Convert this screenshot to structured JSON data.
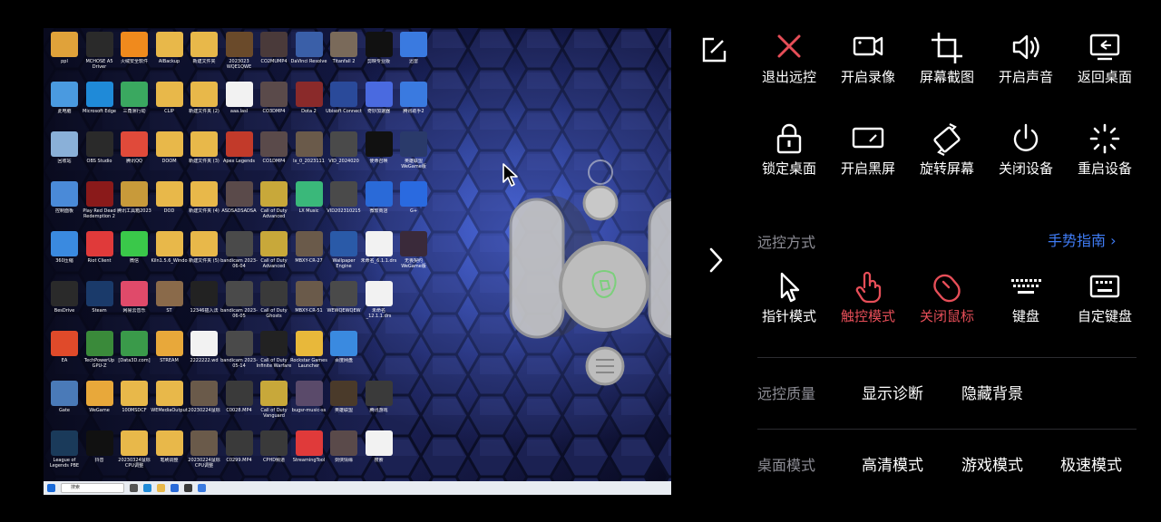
{
  "desktop": {
    "icons": [
      {
        "label": "ppl",
        "color": "#e0a23a"
      },
      {
        "label": "MCHOSE A5 Driver",
        "color": "#2a2a2a"
      },
      {
        "label": "火绒安全软件",
        "color": "#f08a1d"
      },
      {
        "label": "AIBackup",
        "color": "#e8b84a"
      },
      {
        "label": "新建文件夹",
        "color": "#e8b84a"
      },
      {
        "label": "2023023 WQE1QWE",
        "color": "#6a4a2a"
      },
      {
        "label": "CO2MUMP4",
        "color": "#4a3a3a"
      },
      {
        "label": "DaVinci Resolve",
        "color": "#3a5fa8"
      },
      {
        "label": "Titanfall 2",
        "color": "#7a6a5a"
      },
      {
        "label": "剪映专业版",
        "color": "#111111"
      },
      {
        "label": "迅雷",
        "color": "#3a7ae0"
      },
      {
        "label": "此电脑",
        "color": "#4a9ae0"
      },
      {
        "label": "Microsoft Edge",
        "color": "#1f8ad8"
      },
      {
        "label": "三角洲行动",
        "color": "#3aa860"
      },
      {
        "label": "CLIP",
        "color": "#e8b84a"
      },
      {
        "label": "新建文件夹 (2)",
        "color": "#e8b84a"
      },
      {
        "label": "aaa.lasl",
        "color": "#f2f2f2"
      },
      {
        "label": "CO3DMP4",
        "color": "#5a4a4a"
      },
      {
        "label": "Dota 2",
        "color": "#8a2a2a"
      },
      {
        "label": "Ubisoft Connect",
        "color": "#2a4a9a"
      },
      {
        "label": "奇妙加速器",
        "color": "#4a6ae0"
      },
      {
        "label": "腾讯助手2",
        "color": "#3a7ae0"
      },
      {
        "label": "回收站",
        "color": "#8ab0d8"
      },
      {
        "label": "OBS Studio",
        "color": "#2a2a2a"
      },
      {
        "label": "腾讯QQ",
        "color": "#e04a3a"
      },
      {
        "label": "DOOM",
        "color": "#e8b84a"
      },
      {
        "label": "新建文件夹 (3)",
        "color": "#e8b84a"
      },
      {
        "label": "Apex Legends",
        "color": "#c23a2a"
      },
      {
        "label": "CO1DMP4",
        "color": "#5a4a4a"
      },
      {
        "label": "lx_0_2023111",
        "color": "#6a5a4a"
      },
      {
        "label": "VID_2024020",
        "color": "#4a4a4a"
      },
      {
        "label": "使命召唤",
        "color": "#111111"
      },
      {
        "label": "英雄联盟WeGame版",
        "color": "#2a3a6a"
      },
      {
        "label": "控制面板",
        "color": "#4a8ad8"
      },
      {
        "label": "Play Red Dead Redemption 2",
        "color": "#8a1a1a"
      },
      {
        "label": "腾讯工具箱2023",
        "color": "#c89a3a"
      },
      {
        "label": "DOD",
        "color": "#e8b84a"
      },
      {
        "label": "新建文件夹 (4)",
        "color": "#e8b84a"
      },
      {
        "label": "ASDSADSADSA",
        "color": "#5a4a4a"
      },
      {
        "label": "Call of Duty Advanced",
        "color": "#c8a83a"
      },
      {
        "label": "LX Music",
        "color": "#3ab87a"
      },
      {
        "label": "VID202310215",
        "color": "#4a4a4a"
      },
      {
        "label": "微软商店",
        "color": "#2a6ad8"
      },
      {
        "label": "G+",
        "color": "#2a6ae0"
      },
      {
        "label": "360压缩",
        "color": "#3a8ae0"
      },
      {
        "label": "Riot Client",
        "color": "#e03a3a"
      },
      {
        "label": "微信",
        "color": "#3ac84a"
      },
      {
        "label": "Kiln1.5.6_Windo",
        "color": "#e8b84a"
      },
      {
        "label": "新建文件夹 (5)",
        "color": "#e8b84a"
      },
      {
        "label": "bandicam 2023-06-04",
        "color": "#4a4a4a"
      },
      {
        "label": "Call of Duty Advanced",
        "color": "#c8a83a"
      },
      {
        "label": "MBXY-CR-27",
        "color": "#6a5a4a"
      },
      {
        "label": "Wallpaper Engine",
        "color": "#2a5aa8"
      },
      {
        "label": "未命名_6.1.1.drs",
        "color": "#f2f2f2"
      },
      {
        "label": "无畏契约WeGame版",
        "color": "#3a2a3a"
      },
      {
        "label": "BesDrive",
        "color": "#2a2a2a"
      },
      {
        "label": "Steam",
        "color": "#1a3a6a"
      },
      {
        "label": "网易云音乐",
        "color": "#e04a6a"
      },
      {
        "label": "ST",
        "color": "#8a6a4a"
      },
      {
        "label": "12346插入法",
        "color": "#222222"
      },
      {
        "label": "bandicam 2023-06-05",
        "color": "#4a4a4a"
      },
      {
        "label": "Call of Duty Ghosts",
        "color": "#3a3a3a"
      },
      {
        "label": "MBXY-CR-51",
        "color": "#6a5a4a"
      },
      {
        "label": "WEWQEWQEW",
        "color": "#4a4a4a"
      },
      {
        "label": "未命名_12.1.1.drs",
        "color": "#f2f2f2"
      },
      {
        "label": "",
        "color": ""
      },
      {
        "label": "EA",
        "color": "#e04a2a"
      },
      {
        "label": "TechPowerUp GPU-Z",
        "color": "#3a8a3a"
      },
      {
        "label": "[Data3D.com]",
        "color": "#3a9a4a"
      },
      {
        "label": "STREAM",
        "color": "#e8a83a"
      },
      {
        "label": "2222222.wd",
        "color": "#f2f2f2"
      },
      {
        "label": "bandicam 2023-05-14",
        "color": "#4a4a4a"
      },
      {
        "label": "Call of Duty Infinite Warfare",
        "color": "#222222"
      },
      {
        "label": "Rockstar Games Launcher",
        "color": "#e8b83a"
      },
      {
        "label": "百度网盘",
        "color": "#3a8ae0"
      },
      {
        "label": "",
        "color": ""
      },
      {
        "label": "",
        "color": ""
      },
      {
        "label": "Gate",
        "color": "#4a7ab8"
      },
      {
        "label": "WeGame",
        "color": "#e8a83a"
      },
      {
        "label": "100MSDCF",
        "color": "#e8b84a"
      },
      {
        "label": "WEMediaOutput",
        "color": "#e8b84a"
      },
      {
        "label": "20230224鼠标",
        "color": "#6a5a4a"
      },
      {
        "label": "C0028.MP4",
        "color": "#3a3a3a"
      },
      {
        "label": "Call of Duty Vanguard",
        "color": "#c8a83a"
      },
      {
        "label": "bugsr-music-ss",
        "color": "#5a4a6a"
      },
      {
        "label": "英雄联盟",
        "color": "#4a3a2a"
      },
      {
        "label": "腾讯游戏",
        "color": "#3a3a3a"
      },
      {
        "label": "",
        "color": ""
      },
      {
        "label": "League of Legends PBE",
        "color": "#1a3a5a"
      },
      {
        "label": "抖音",
        "color": "#111111"
      },
      {
        "label": "20230324鼠标CPU调整",
        "color": "#e8b84a"
      },
      {
        "label": "笔刷调整",
        "color": "#e8b84a"
      },
      {
        "label": "20230224鼠标CPU调整",
        "color": "#6a5a4a"
      },
      {
        "label": "C0299.MP4",
        "color": "#3a3a3a"
      },
      {
        "label": "CPHD频道",
        "color": "#3a3a3a"
      },
      {
        "label": "StreamingTool",
        "color": "#e03a3a"
      },
      {
        "label": "剑侠情缘",
        "color": "#5a4a4a"
      },
      {
        "label": "搜索",
        "color": "#f2f2f2"
      },
      {
        "label": "",
        "color": ""
      }
    ],
    "taskbar": {
      "search_placeholder": "搜索"
    }
  },
  "panel": {
    "row1": [
      {
        "label": "退出远控",
        "icon": "close-icon",
        "accent": true
      },
      {
        "label": "开启录像",
        "icon": "video-camera-icon",
        "accent": false
      },
      {
        "label": "屏幕截图",
        "icon": "crop-icon",
        "accent": false
      },
      {
        "label": "开启声音",
        "icon": "speaker-icon",
        "accent": false
      },
      {
        "label": "返回桌面",
        "icon": "desktop-icon",
        "accent": false
      }
    ],
    "row2": [
      {
        "label": "锁定桌面",
        "icon": "lock-icon",
        "accent": false
      },
      {
        "label": "开启黑屏",
        "icon": "black-screen-icon",
        "accent": false
      },
      {
        "label": "旋转屏幕",
        "icon": "rotate-screen-icon",
        "accent": false
      },
      {
        "label": "关闭设备",
        "icon": "power-icon",
        "accent": false
      },
      {
        "label": "重启设备",
        "icon": "restart-icon",
        "accent": false
      }
    ],
    "control_mode_label": "远控方式",
    "gesture_guide": "手势指南 ›",
    "row3": [
      {
        "label": "指针模式",
        "icon": "pointer-icon",
        "accent": false
      },
      {
        "label": "触控模式",
        "icon": "touch-icon",
        "accent": true
      },
      {
        "label": "关闭鼠标",
        "icon": "mouse-off-icon",
        "accent": true
      },
      {
        "label": "键盘",
        "icon": "keyboard-icon",
        "accent": false
      },
      {
        "label": "自定键盘",
        "icon": "custom-keyboard-icon",
        "accent": false
      }
    ],
    "quality_label": "远控质量",
    "quality_options": [
      "显示诊断",
      "隐藏背景"
    ],
    "desktop_mode_label": "桌面模式",
    "desktop_modes": [
      {
        "label": "高清模式",
        "selected": true
      },
      {
        "label": "游戏模式",
        "selected": false
      },
      {
        "label": "极速模式",
        "selected": false
      }
    ],
    "accent_color": "#e64e58",
    "link_color": "#3f7cf5"
  }
}
